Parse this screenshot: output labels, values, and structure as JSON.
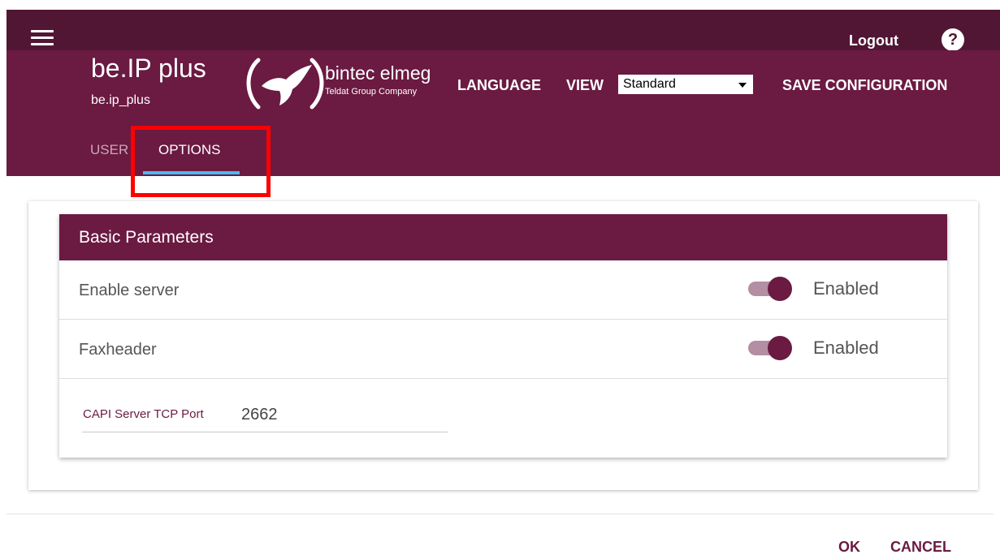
{
  "topbar": {
    "menu_icon": "hamburger-menu-icon",
    "logout_label": "Logout",
    "help_icon": "help-icon",
    "help_glyph": "?"
  },
  "header": {
    "device_name": "be.IP plus",
    "device_id": "be.ip_plus",
    "brand_name": "bintec elmeg",
    "brand_tagline": "Teldat Group Company",
    "language_label": "LANGUAGE",
    "view_label": "VIEW",
    "view_selected": "Standard",
    "save_label": "SAVE CONFIGURATION"
  },
  "tabs": [
    {
      "label": "USER",
      "active": false
    },
    {
      "label": "OPTIONS",
      "active": true
    }
  ],
  "panel": {
    "title": "Basic Parameters",
    "rows": [
      {
        "label": "Enable server",
        "state": "Enabled",
        "on": true
      },
      {
        "label": "Faxheader",
        "state": "Enabled",
        "on": true
      }
    ],
    "port": {
      "label": "CAPI Server TCP Port",
      "value": "2662"
    }
  },
  "footer": {
    "ok_label": "OK",
    "cancel_label": "CANCEL"
  },
  "colors": {
    "topbar": "#521635",
    "header": "#6b1a42",
    "tab_underline": "#4ab9f0",
    "highlight": "#ff0000"
  }
}
